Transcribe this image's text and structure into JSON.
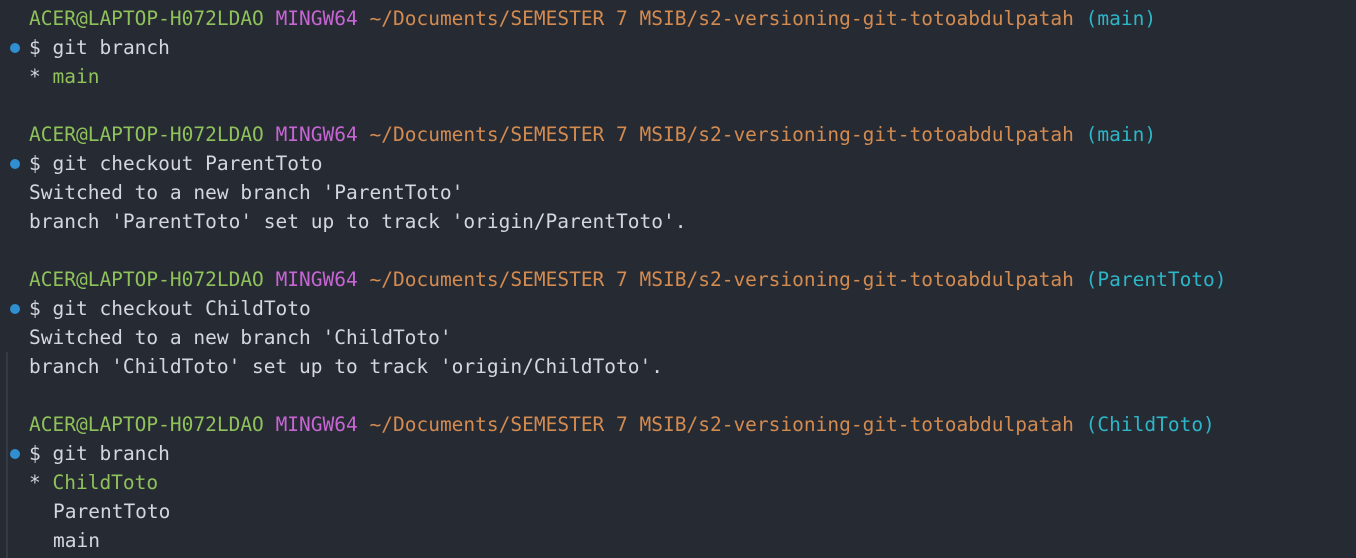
{
  "prompt": {
    "user_host": "ACER@LAPTOP-H072LDAO",
    "shell": "MINGW64",
    "path": "~/Documents/SEMESTER 7 MSIB/s2-versioning-git-totoabdulpatah",
    "symbol": "$"
  },
  "blocks": [
    {
      "branch": "(main)",
      "command": "git branch",
      "output": [
        {
          "marker": "* ",
          "text": "main",
          "current": true
        }
      ]
    },
    {
      "branch": "(main)",
      "command": "git checkout ParentToto",
      "output": [
        {
          "text": "Switched to a new branch 'ParentToto'"
        },
        {
          "text": "branch 'ParentToto' set up to track 'origin/ParentToto'."
        }
      ]
    },
    {
      "branch": "(ParentToto)",
      "command": "git checkout ChildToto",
      "output": [
        {
          "text": "Switched to a new branch 'ChildToto'"
        },
        {
          "text": "branch 'ChildToto' set up to track 'origin/ChildToto'."
        }
      ]
    },
    {
      "branch": "(ChildToto)",
      "command": "git branch",
      "output": [
        {
          "marker": "* ",
          "text": "ChildToto",
          "current": true
        },
        {
          "text": "ParentToto",
          "indent": true
        },
        {
          "text": "main",
          "indent": true
        }
      ]
    }
  ],
  "colors": {
    "background": "#262a33",
    "user_host": "#8fc25a",
    "shell": "#c765d4",
    "path": "#d38b50",
    "branch": "#2db6c7",
    "text": "#d4d7dd",
    "decoration_dot": "#2f8fd0"
  }
}
